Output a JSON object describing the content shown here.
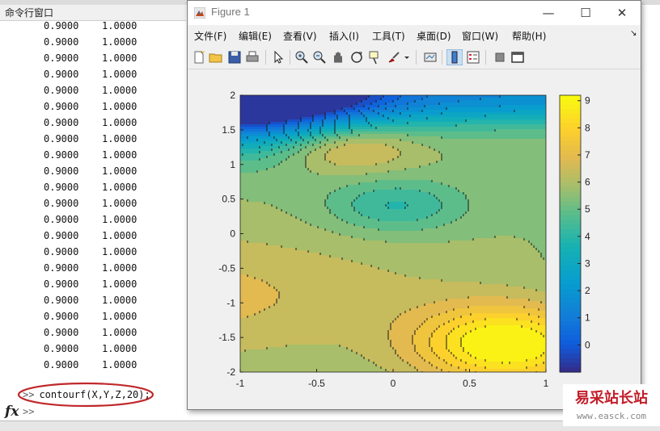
{
  "command_window": {
    "title": "命令行窗口",
    "rows": [
      [
        "0.9000",
        "1.0000"
      ],
      [
        "0.9000",
        "1.0000"
      ],
      [
        "0.9000",
        "1.0000"
      ],
      [
        "0.9000",
        "1.0000"
      ],
      [
        "0.9000",
        "1.0000"
      ],
      [
        "0.9000",
        "1.0000"
      ],
      [
        "0.9000",
        "1.0000"
      ],
      [
        "0.9000",
        "1.0000"
      ],
      [
        "0.9000",
        "1.0000"
      ],
      [
        "0.9000",
        "1.0000"
      ],
      [
        "0.9000",
        "1.0000"
      ],
      [
        "0.9000",
        "1.0000"
      ],
      [
        "0.9000",
        "1.0000"
      ],
      [
        "0.9000",
        "1.0000"
      ],
      [
        "0.9000",
        "1.0000"
      ],
      [
        "0.9000",
        "1.0000"
      ],
      [
        "0.9000",
        "1.0000"
      ],
      [
        "0.9000",
        "1.0000"
      ],
      [
        "0.9000",
        "1.0000"
      ],
      [
        "0.9000",
        "1.0000"
      ],
      [
        "0.9000",
        "1.0000"
      ],
      [
        "0.9000",
        "1.0000"
      ]
    ],
    "prompt": ">>",
    "last_command": "contourf(X,Y,Z,20);",
    "fx_label": "fx",
    "prompt2": ">>",
    "highlight_color": "#c0282a"
  },
  "figure_window": {
    "title": "Figure 1",
    "controls": {
      "minimize": "—",
      "maximize": "☐",
      "close": "✕"
    },
    "menu": [
      "文件(F)",
      "编辑(E)",
      "查看(V)",
      "插入(I)",
      "工具(T)",
      "桌面(D)",
      "窗口(W)",
      "帮助(H)"
    ],
    "toolbar_icons": [
      "new-figure-icon",
      "open-file-icon",
      "save-icon",
      "print-icon",
      "pointer-icon",
      "zoom-in-icon",
      "zoom-out-icon",
      "pan-icon",
      "rotate-3d-icon",
      "data-cursor-icon",
      "brush-icon",
      "brush-dropdown-icon",
      "link-plot-icon",
      "insert-colorbar-icon",
      "insert-legend-icon",
      "hide-plot-tools-icon",
      "show-plot-tools-icon"
    ]
  },
  "chart_data": {
    "type": "heatmap",
    "plot_kind": "filled contour",
    "xlim": [
      -1,
      1
    ],
    "ylim": [
      -2,
      2
    ],
    "x_ticks": [
      "-1",
      "-0.5",
      "0",
      "0.5",
      "1"
    ],
    "y_ticks": [
      "2",
      "1.5",
      "1",
      "0.5",
      "0",
      "-0.5",
      "-1",
      "-1.5",
      "-2"
    ],
    "colorbar_ticks": [
      "9",
      "8",
      "7",
      "6",
      "5",
      "4",
      "3",
      "2",
      "1",
      "0"
    ],
    "colorbar_range": [
      -1,
      9.2
    ],
    "levels": 20,
    "colormap": "parula",
    "features": [
      {
        "kind": "maximum",
        "x": 0.75,
        "y": -1.6,
        "approx_value": 9
      },
      {
        "kind": "local maximum",
        "x": -0.3,
        "y": 1.25,
        "approx_value": 7.3
      },
      {
        "kind": "minimum",
        "x": 0.0,
        "y": 0.4,
        "approx_value": 4.1
      },
      {
        "kind": "minimum",
        "x": -1.0,
        "y": 2.0,
        "approx_value": -1
      }
    ]
  },
  "watermark": {
    "title": "易采站长站",
    "url": "www.easck.com"
  }
}
